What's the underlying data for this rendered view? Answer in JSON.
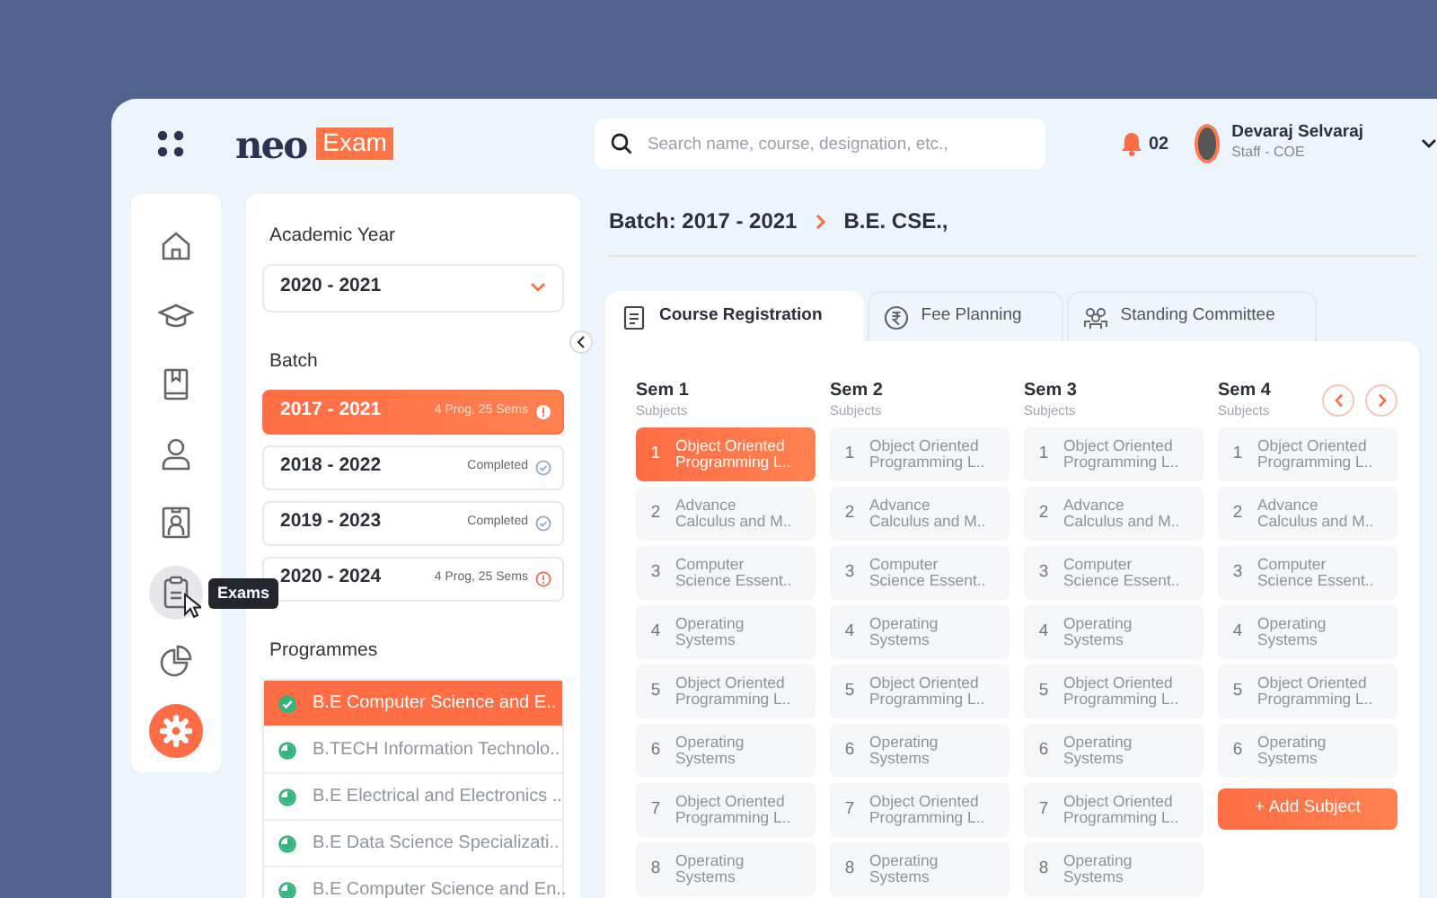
{
  "header": {
    "logo": {
      "word": "neo",
      "badge": "Exam"
    },
    "search": {
      "placeholder": "Search name, course, designation, etc.,"
    },
    "notifications": {
      "count": "02"
    },
    "user": {
      "name": "Devaraj Selvaraj",
      "role": "Staff - COE"
    }
  },
  "nav_rail": [
    {
      "kind": "home",
      "selected": false,
      "hovered": false
    },
    {
      "kind": "graduation",
      "selected": false,
      "hovered": false
    },
    {
      "kind": "book",
      "selected": false,
      "hovered": false
    },
    {
      "kind": "user",
      "selected": false,
      "hovered": false
    },
    {
      "kind": "badge",
      "selected": false,
      "hovered": false
    },
    {
      "kind": "clipboard",
      "selected": false,
      "hovered": true,
      "tooltip": "Exams"
    },
    {
      "kind": "piechart",
      "selected": false,
      "hovered": false
    },
    {
      "kind": "settings",
      "selected": true,
      "hovered": false
    }
  ],
  "filters": {
    "academic_year": {
      "label": "Academic Year",
      "value": "2020 - 2021"
    },
    "batch": {
      "label": "Batch",
      "items": [
        {
          "year": "2017 - 2021",
          "info": "4 Prog, 25 Sems",
          "kind": "info",
          "selected": true
        },
        {
          "year": "2018 - 2022",
          "info": "Completed",
          "kind": "completed",
          "selected": false
        },
        {
          "year": "2019 - 2023",
          "info": "Completed",
          "kind": "completed",
          "selected": false
        },
        {
          "year": "2020 - 2024",
          "info": "4 Prog, 25 Sems",
          "kind": "pending",
          "selected": false
        }
      ]
    },
    "programmes": {
      "label": "Programmes",
      "items": [
        {
          "name": "B.E Computer Science and E..",
          "kind": "done",
          "selected": true
        },
        {
          "name": "B.TECH Information Technolo..",
          "kind": "progress",
          "selected": false
        },
        {
          "name": "B.E Electrical and Electronics ..",
          "kind": "progress",
          "selected": false
        },
        {
          "name": "B.E Data Science Specializati..",
          "kind": "progress",
          "selected": false
        },
        {
          "name": "B.E Computer Science and En..",
          "kind": "progress",
          "selected": false
        }
      ]
    }
  },
  "breadcrumb": [
    "Batch: 2017 - 2021",
    "B.E. CSE.,"
  ],
  "tabs": [
    {
      "label": "Course Registration",
      "kind": "clipboard",
      "selected": true
    },
    {
      "label": "Fee Planning",
      "kind": "rupee",
      "selected": false
    },
    {
      "label": "Standing Committee",
      "kind": "people",
      "selected": false
    }
  ],
  "semesters": [
    {
      "title": "Sem 1",
      "subtitle": "Subjects",
      "subjects": [
        {
          "number": "1",
          "name": "Object Oriented\nProgramming L..",
          "selected": true
        },
        {
          "number": "2",
          "name": "Advance\nCalculus and M..",
          "selected": false
        },
        {
          "number": "3",
          "name": "Computer\nScience Essent..",
          "selected": false
        },
        {
          "number": "4",
          "name": "Operating\nSystems",
          "selected": false
        },
        {
          "number": "5",
          "name": "Object Oriented\nProgramming L..",
          "selected": false
        },
        {
          "number": "6",
          "name": "Operating\nSystems",
          "selected": false
        },
        {
          "number": "7",
          "name": "Object Oriented\nProgramming L..",
          "selected": false
        },
        {
          "number": "8",
          "name": "Operating\nSystems",
          "selected": false
        }
      ]
    },
    {
      "title": "Sem 2",
      "subtitle": "Subjects",
      "subjects": [
        {
          "number": "1",
          "name": "Object Oriented\nProgramming L..",
          "selected": false
        },
        {
          "number": "2",
          "name": "Advance\nCalculus and M..",
          "selected": false
        },
        {
          "number": "3",
          "name": "Computer\nScience Essent..",
          "selected": false
        },
        {
          "number": "4",
          "name": "Operating\nSystems",
          "selected": false
        },
        {
          "number": "5",
          "name": "Object Oriented\nProgramming L..",
          "selected": false
        },
        {
          "number": "6",
          "name": "Operating\nSystems",
          "selected": false
        },
        {
          "number": "7",
          "name": "Object Oriented\nProgramming L..",
          "selected": false
        },
        {
          "number": "8",
          "name": "Operating\nSystems",
          "selected": false
        }
      ]
    },
    {
      "title": "Sem 3",
      "subtitle": "Subjects",
      "subjects": [
        {
          "number": "1",
          "name": "Object Oriented\nProgramming L..",
          "selected": false
        },
        {
          "number": "2",
          "name": "Advance\nCalculus and M..",
          "selected": false
        },
        {
          "number": "3",
          "name": "Computer\nScience Essent..",
          "selected": false
        },
        {
          "number": "4",
          "name": "Operating\nSystems",
          "selected": false
        },
        {
          "number": "5",
          "name": "Object Oriented\nProgramming L..",
          "selected": false
        },
        {
          "number": "6",
          "name": "Operating\nSystems",
          "selected": false
        },
        {
          "number": "7",
          "name": "Object Oriented\nProgramming L..",
          "selected": false
        },
        {
          "number": "8",
          "name": "Operating\nSystems",
          "selected": false
        }
      ]
    },
    {
      "title": "Sem 4",
      "subtitle": "Subjects",
      "subjects": [
        {
          "number": "1",
          "name": "Object Oriented\nProgramming L..",
          "selected": false
        },
        {
          "number": "2",
          "name": "Advance\nCalculus and M..",
          "selected": false
        },
        {
          "number": "3",
          "name": "Computer\nScience Essent..",
          "selected": false
        },
        {
          "number": "4",
          "name": "Operating\nSystems",
          "selected": false
        },
        {
          "number": "5",
          "name": "Object Oriented\nProgramming L..",
          "selected": false
        },
        {
          "number": "6",
          "name": "Operating\nSystems",
          "selected": false
        }
      ],
      "add_button": "+ Add Subject"
    }
  ]
}
